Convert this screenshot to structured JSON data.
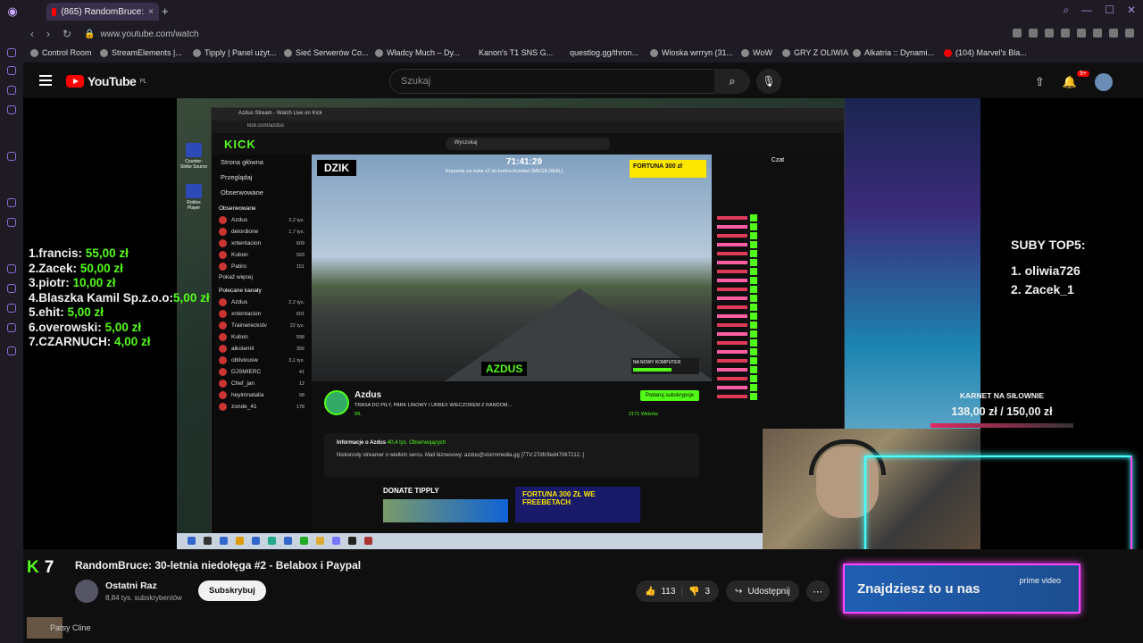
{
  "browser": {
    "tab_title": "(865) RandomBruce:",
    "url": "www.youtube.com/watch",
    "bookmarks": [
      "Control Room",
      "StreamElements |...",
      "Tipply | Panel użyt...",
      "Sieć Serwerów Co...",
      "Władcy Much – Dy...",
      "Kanon's T1 SNS G...",
      "questlog.gg/thron...",
      "Wioska wrrryn (31...",
      "WoW",
      "GRY Z OLIWIA",
      "Alkatria :: Dynami...",
      "(104) Marvel's Bla..."
    ]
  },
  "youtube": {
    "logo_text": "YouTube",
    "logo_region": "PL",
    "search_placeholder": "Szukaj",
    "notifications_badge": "9+"
  },
  "overlay": {
    "top_donors": [
      {
        "rank_name": "1.francis:",
        "amount": "55,00 zł"
      },
      {
        "rank_name": "2.Zacek:",
        "amount": "50,00 zł"
      },
      {
        "rank_name": "3.piotr:",
        "amount": "10,00 zł"
      },
      {
        "rank_name": "4.Blaszka Kamil Sp.z.o.o:",
        "amount": "5,00 zł"
      },
      {
        "rank_name": "5.ehit:",
        "amount": "5,00 zł"
      },
      {
        "rank_name": "6.overowski:",
        "amount": "5,00 zł"
      },
      {
        "rank_name": "7.CZARNUCH:",
        "amount": "4,00 zł"
      }
    ],
    "suby_title": "SUBY TOP5:",
    "suby": [
      "1. oliwia726",
      "2. Zacek_1"
    ],
    "karnet_title": "KARNET NA SIŁOWNIE",
    "karnet_value": "138,00 zł / 150,00 zł",
    "desktop_icons": [
      "Counter-Strike Source",
      "Roblox Player"
    ]
  },
  "kick": {
    "browser_tab": "Azdus Stream - Watch Live on Kick",
    "url": "kick.com/azdus",
    "logo": "KICK",
    "search": "Wyszukaj",
    "nav": [
      "Strona główna",
      "Przeglądaj",
      "Obserwowane"
    ],
    "followed_header": "Obserwowane",
    "followed": [
      {
        "name": "Azdus",
        "count": "2,2 tys."
      },
      {
        "name": "delordione",
        "count": "1,7 tys."
      },
      {
        "name": "xntentacion",
        "count": "609"
      },
      {
        "name": "Kubon",
        "count": "593"
      },
      {
        "name": "Patiro",
        "count": "151"
      }
    ],
    "show_more": "Pokaż więcej",
    "recommended_header": "Polecane kanały",
    "recommended": [
      {
        "name": "Azdus",
        "count": "2,2 tys."
      },
      {
        "name": "xntentacion",
        "count": "601"
      },
      {
        "name": "Trainwreckstv",
        "count": "22 tys."
      },
      {
        "name": "Kubon",
        "count": "598"
      },
      {
        "name": "aikoiemil",
        "count": "356"
      },
      {
        "name": "obliviousw",
        "count": "3,1 tys."
      },
      {
        "name": "DJSMIERC",
        "count": "41"
      },
      {
        "name": "Chef_jan",
        "count": "12"
      },
      {
        "name": "heyimnatalia",
        "count": "98"
      },
      {
        "name": "zonde_41",
        "count": "178"
      }
    ],
    "video": {
      "brand": "DZIK",
      "timer": "71:41:29",
      "timer_sub": "Kręcenie za suba x2 do końca licznika! [MEGA DEAL]",
      "fortuna": "FORTUNA 300 zł",
      "streamer_tag": "AZDUS",
      "pc_tag": "NA NOWY KOMPUTER"
    },
    "stream": {
      "name": "Azdus",
      "title": "TRASA DO PIŁY, PARK LINOWY I URBEX WIECZOREM Z RANDOM...",
      "category": "IRL",
      "subscribe": "Podaruj subskrypcje",
      "viewers": "2171 Widzów",
      "about_title": "Informacje o Azdus",
      "about_followers": "40,4 tys. Obserwujących",
      "about_text": "Niskorosły streamer o wielkim sercu. Mail biznesowy: azdus@stormmedia.gg [7TV:27dfc9ed47067212..]",
      "donate": "DONATE TIPPLY",
      "fortuna_ad": "FORTUNA 300 ZŁ WE FREEBETACH"
    },
    "chat_header": "Czat"
  },
  "video": {
    "kick_number": "7",
    "title": "RandomBruce: 30-letnia niedołęga #2 - Belabox i Paypal",
    "channel": "Ostatni Raz",
    "subscribers": "8,84 tys. subskrybentów",
    "subscribe": "Subskrybuj",
    "likes": "113",
    "dislikes": "3",
    "share": "Udostępnij",
    "ad_text": "Znajdziesz to u nas",
    "ad_brand": "prime video",
    "next_channel": "Patsy Cline"
  }
}
